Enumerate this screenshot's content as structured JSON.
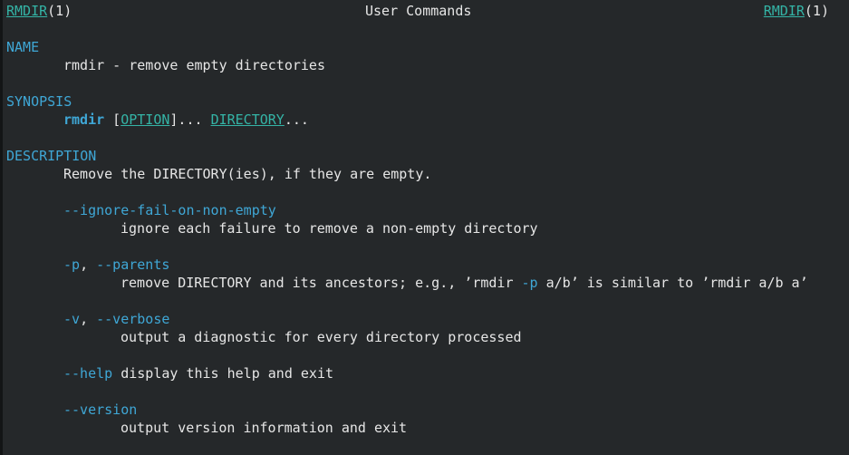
{
  "header": {
    "left_name": "RMDIR",
    "left_section": "(1)",
    "center": "User Commands",
    "right_name": "RMDIR",
    "right_section": "(1)"
  },
  "name": {
    "heading": "NAME",
    "text": "rmdir - remove empty directories"
  },
  "synopsis": {
    "heading": "SYNOPSIS",
    "command": "rmdir",
    "open_bracket": " [",
    "option": "OPTION",
    "close_bracket": "]... ",
    "directory": "DIRECTORY",
    "ellipsis": "..."
  },
  "description": {
    "heading": "DESCRIPTION",
    "intro": "Remove the DIRECTORY(ies), if they are empty.",
    "options": {
      "ignore_fail": {
        "flag": "--ignore-fail-on-non-empty",
        "desc": "ignore each failure to remove a non-empty directory"
      },
      "parents": {
        "short": "-p",
        "sep": ", ",
        "long": "--parents",
        "desc_before": "remove DIRECTORY and its ancestors; e.g., ’rmdir ",
        "desc_flag": "-p",
        "desc_after": " a/b’ is similar to ’rmdir a/b a’"
      },
      "verbose": {
        "short": "-v",
        "sep": ", ",
        "long": "--verbose",
        "desc": "output a diagnostic for every directory processed"
      },
      "help": {
        "flag": "--help",
        "desc": " display this help and exit"
      },
      "version": {
        "flag": "--version",
        "desc": "output version information and exit"
      }
    }
  },
  "colors": {
    "background": "#25282a",
    "text": "#e6e6e6",
    "heading_blue": "#3fa7d6",
    "link_teal": "#34b4a6"
  }
}
